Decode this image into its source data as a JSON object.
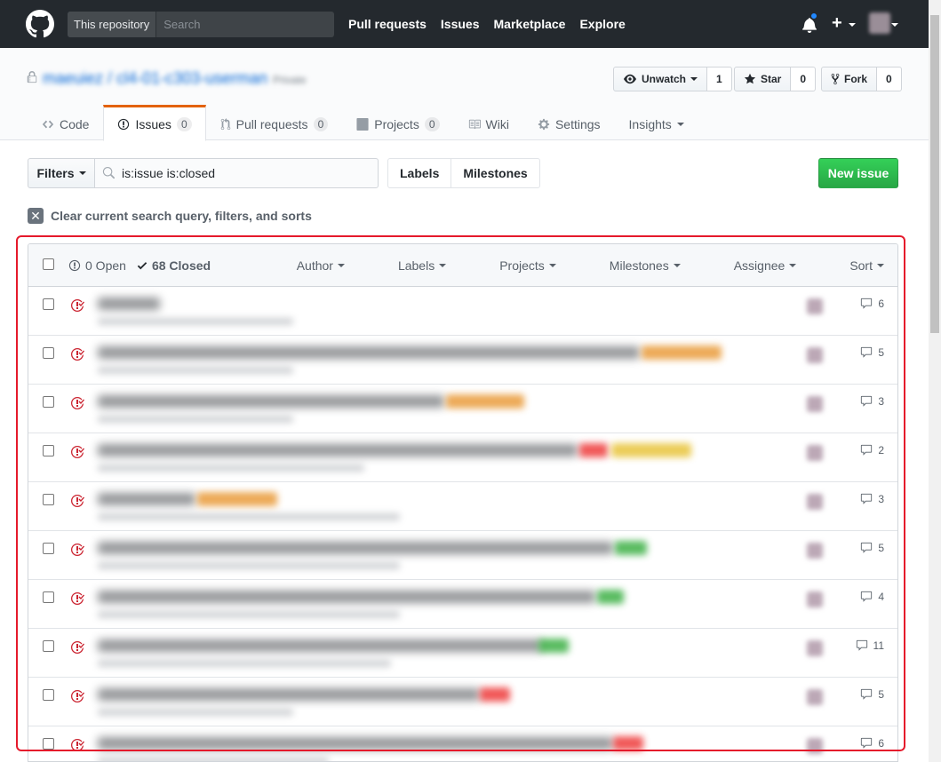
{
  "header": {
    "search_scope": "This repository",
    "search_placeholder": "Search",
    "nav": [
      "Pull requests",
      "Issues",
      "Marketplace",
      "Explore"
    ]
  },
  "repo": {
    "owner": "maeuiez",
    "name": "cl4-01-c303-userman",
    "visibility": "Private",
    "watch_label": "Unwatch",
    "watch_count": "1",
    "star_label": "Star",
    "star_count": "0",
    "fork_label": "Fork",
    "fork_count": "0",
    "tabs": [
      {
        "label": "Code",
        "icon": "code-icon"
      },
      {
        "label": "Issues",
        "counter": "0",
        "icon": "issue-opened-icon"
      },
      {
        "label": "Pull requests",
        "counter": "0",
        "icon": "git-pull-request-icon"
      },
      {
        "label": "Projects",
        "counter": "0",
        "icon": "project-icon"
      },
      {
        "label": "Wiki",
        "icon": "book-icon"
      },
      {
        "label": "Settings",
        "icon": "gear-icon"
      },
      {
        "label": "Insights",
        "icon": "chevron-down-icon"
      }
    ]
  },
  "subnav": {
    "filters_label": "Filters",
    "query": "is:issue is:closed",
    "labels_label": "Labels",
    "milestones_label": "Milestones",
    "new_issue_label": "New issue",
    "clear_label": "Clear current search query, filters, and sorts"
  },
  "issues_header": {
    "open_label": "0 Open",
    "closed_label": "68 Closed",
    "filters": [
      "Author",
      "Labels",
      "Projects",
      "Milestones",
      "Assignee",
      "Sort"
    ]
  },
  "issues": [
    {
      "comments": "6"
    },
    {
      "comments": "5"
    },
    {
      "comments": "3"
    },
    {
      "comments": "2"
    },
    {
      "comments": "3"
    },
    {
      "comments": "5"
    },
    {
      "comments": "4"
    },
    {
      "comments": "11"
    },
    {
      "comments": "5"
    },
    {
      "comments": "6"
    }
  ],
  "colors": {
    "header_bg": "#24292e",
    "link": "#0366d6",
    "closed_icon": "#cb2431",
    "new_issue_green": "#28a745",
    "highlight_box": "#e5192b",
    "label_orange": "#e99b3a",
    "label_yellow": "#e8c43a",
    "label_red": "#ee3b3b",
    "label_green": "#3cb045"
  }
}
